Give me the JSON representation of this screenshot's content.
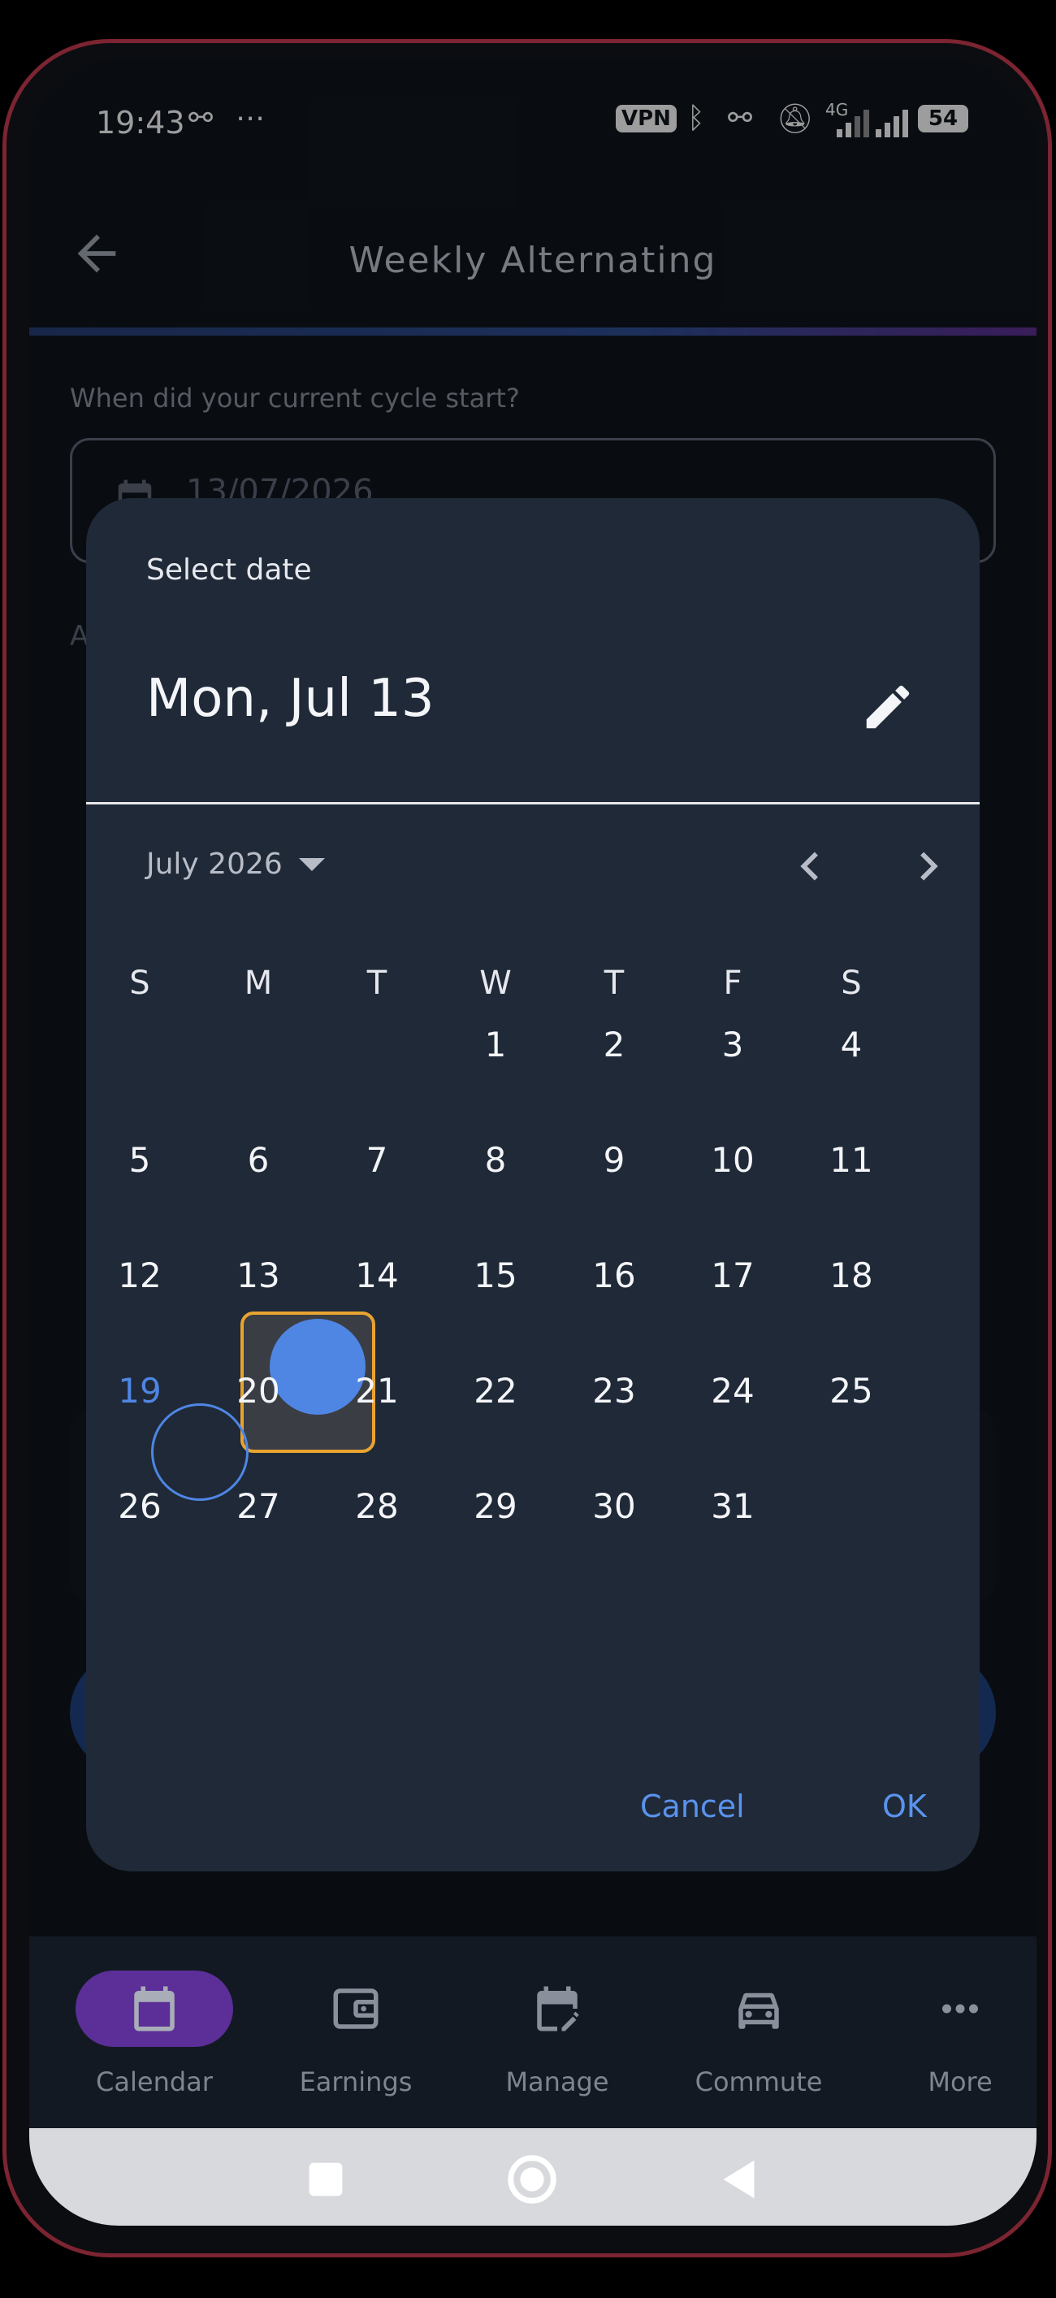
{
  "status_bar": {
    "time": "19:43",
    "vpn": "VPN",
    "network": "4G",
    "battery": "54"
  },
  "app_bar": {
    "title": "Weekly Alternating"
  },
  "form": {
    "question": "When did your current cycle start?",
    "date_value": "13/07/2026",
    "next_label_start": "A"
  },
  "dialog": {
    "label": "Select date",
    "selected_header": "Mon, Jul 13",
    "month_label": "July 2026",
    "weekdays": [
      "S",
      "M",
      "T",
      "W",
      "T",
      "F",
      "S"
    ],
    "weeks": [
      [
        "",
        "",
        "",
        "1",
        "2",
        "3",
        "4"
      ],
      [
        "5",
        "6",
        "7",
        "8",
        "9",
        "10",
        "11"
      ],
      [
        "12",
        "13",
        "14",
        "15",
        "16",
        "17",
        "18"
      ],
      [
        "19",
        "20",
        "21",
        "22",
        "23",
        "24",
        "25"
      ],
      [
        "26",
        "27",
        "28",
        "29",
        "30",
        "31",
        ""
      ]
    ],
    "selected_day": "13",
    "today": "19",
    "cancel": "Cancel",
    "ok": "OK"
  },
  "bottom_nav": [
    {
      "label": "Calendar",
      "icon": "calendar-icon",
      "active": true
    },
    {
      "label": "Earnings",
      "icon": "wallet-icon",
      "active": false
    },
    {
      "label": "Manage",
      "icon": "edit-calendar-icon",
      "active": false
    },
    {
      "label": "Commute",
      "icon": "car-icon",
      "active": false
    },
    {
      "label": "More",
      "icon": "more-horiz-icon",
      "active": false
    }
  ],
  "colors": {
    "accent": "#4f86e3",
    "focus": "#e8a431",
    "nav_active": "#5b2f97",
    "dialog_bg": "#1f2937"
  }
}
